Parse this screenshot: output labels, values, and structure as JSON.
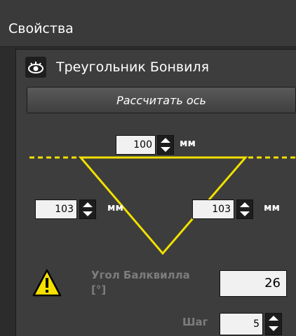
{
  "panel": {
    "title": "Свойства"
  },
  "group": {
    "title": "Треугольник Бонвиля",
    "calc_button": "Рассчитать ось"
  },
  "top_width": {
    "value": "100",
    "unit": "мм"
  },
  "left_side": {
    "value": "103",
    "unit": "мм"
  },
  "right_side": {
    "value": "103",
    "unit": "мм"
  },
  "angle": {
    "label_line1": "Угол Балквилла",
    "label_line2": "[°]",
    "value": "26"
  },
  "step": {
    "label": "Шаг",
    "value": "5"
  },
  "colors": {
    "triangle": "#f0e000",
    "warning": "#f5e000",
    "background": "#2c2c2c"
  },
  "icons": [
    "eye-icon",
    "warning-icon",
    "spinner-up-icon",
    "spinner-down-icon"
  ]
}
